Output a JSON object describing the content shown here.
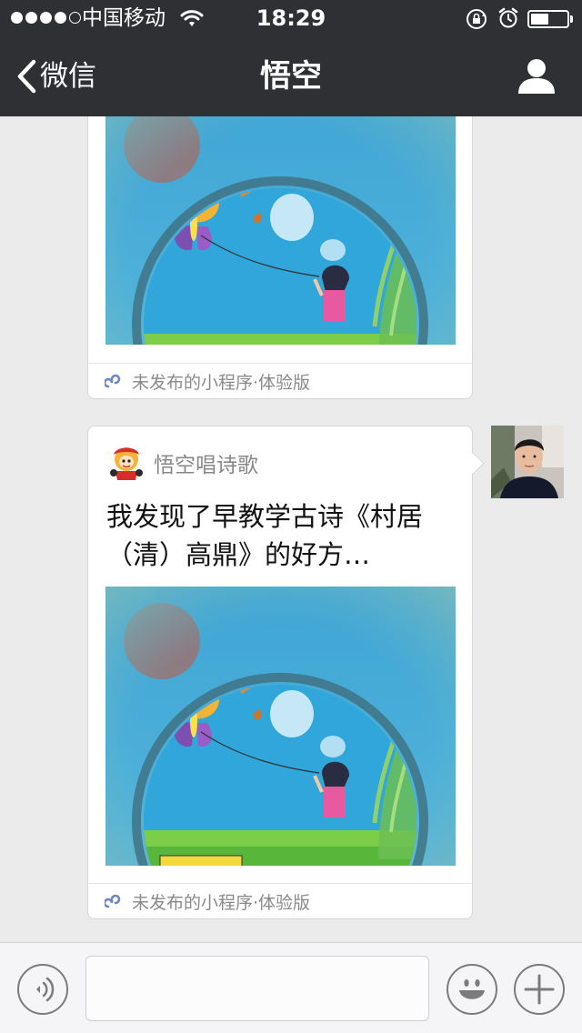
{
  "status_bar": {
    "carrier": "中国移动",
    "time": "18:29",
    "signal_bars_filled": 4,
    "signal_bars_total": 5,
    "battery_level": 0.5,
    "icons": [
      "signal-icon",
      "wifi-icon",
      "orientation-lock-icon",
      "alarm-icon",
      "battery-icon"
    ]
  },
  "nav": {
    "back_label": "微信",
    "title": "悟空",
    "back_icon": "chevron-left-icon",
    "profile_icon": "person-icon"
  },
  "messages": [
    {
      "type": "mini-program-card",
      "partially_visible": true,
      "image": "child-flying-butterfly-kite-painting",
      "footer_label": "未发布的小程序·体验版",
      "footer_icon": "mini-program-icon"
    },
    {
      "type": "mini-program-card",
      "sender": "self",
      "app_name": "悟空唱诗歌",
      "app_icon": "monkey-king-logo",
      "title": "我发现了早教学古诗《村居 （清）高鼎》的好方…",
      "image": "child-flying-butterfly-kite-painting",
      "footer_label": "未发布的小程序·体验版",
      "footer_icon": "mini-program-icon",
      "avatar": "user-avatar"
    }
  ],
  "input_bar": {
    "value": "",
    "icons": [
      "voice-icon",
      "emoji-icon",
      "plus-icon"
    ]
  },
  "colors": {
    "nav_background": "#2e3033",
    "chat_background": "#ebebeb",
    "card_border": "#d6d6d6",
    "secondary_text": "#888888",
    "mini_program_icon": "#6e87c5"
  }
}
